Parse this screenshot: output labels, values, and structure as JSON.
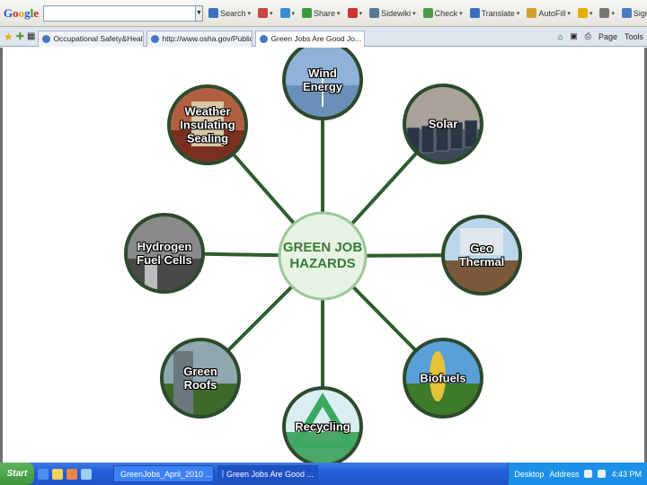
{
  "toolbar": {
    "logo": "Google",
    "search_value": "",
    "buttons": [
      {
        "label": "Search",
        "icon": "search-icon"
      },
      {
        "label": "",
        "icon": "popup-blocker-icon"
      },
      {
        "label": "",
        "icon": "bookmark-plus-icon"
      },
      {
        "label": "Share",
        "icon": "share-icon"
      },
      {
        "label": "",
        "icon": "block-icon"
      },
      {
        "label": "Sidewiki",
        "icon": "sidewiki-icon"
      },
      {
        "label": "Check",
        "icon": "check-icon"
      },
      {
        "label": "Translate",
        "icon": "translate-icon"
      },
      {
        "label": "AutoFill",
        "icon": "autofill-icon"
      },
      {
        "label": "",
        "icon": "highlight-icon"
      },
      {
        "label": "",
        "icon": "wrench-icon"
      },
      {
        "label": "Sign In",
        "icon": "sign-in-icon"
      }
    ]
  },
  "tabs": [
    {
      "label": "Occupational Safety&Health ...",
      "active": false
    },
    {
      "label": "http://www.osha.gov/Public ...",
      "active": false
    },
    {
      "label": "Green Jobs Are Good Jo...",
      "active": true
    }
  ],
  "tab_tools": {
    "page": "Page",
    "tools": "Tools"
  },
  "diagram": {
    "center": "GREEN JOB\nHAZARDS",
    "nodes": [
      {
        "id": "wind",
        "label": "Wind\nEnergy",
        "sky": "#8fb2d8",
        "ground": "#6a8fb8"
      },
      {
        "id": "solar",
        "label": "Solar",
        "sky": "#a9a39a",
        "ground": "#3d4a57"
      },
      {
        "id": "geothermal",
        "label": "Geo\nThermal",
        "sky": "#b9d6ea",
        "ground": "#7a5a3a"
      },
      {
        "id": "biofuels",
        "label": "Biofuels",
        "sky": "#5aa0d8",
        "ground": "#3d7a2a"
      },
      {
        "id": "recycling",
        "label": "Recycling",
        "sky": "#d8eef0",
        "ground": "#4aa868"
      },
      {
        "id": "green-roofs",
        "label": "Green\nRoofs",
        "sky": "#8fa8b0",
        "ground": "#3d6a2a"
      },
      {
        "id": "hydrogen",
        "label": "Hydrogen\nFuel Cells",
        "sky": "#8a8a8a",
        "ground": "#4a4a4a"
      },
      {
        "id": "weather",
        "label": "Weather\nInsulating\nSealing",
        "sky": "#b06040",
        "ground": "#7a3020"
      }
    ],
    "line_color": "#2e5e2e",
    "center_fill": "#e7f3e2",
    "ring_color": "#2d4a2d"
  },
  "taskbar": {
    "start": "Start",
    "tasks": [
      {
        "label": "GreenJobs_April_2010 ...",
        "active": false
      },
      {
        "label": "Green Jobs Are Good ...",
        "active": true
      }
    ],
    "tray": {
      "desktop": "Desktop",
      "address": "Address",
      "time": "4:43 PM"
    }
  }
}
